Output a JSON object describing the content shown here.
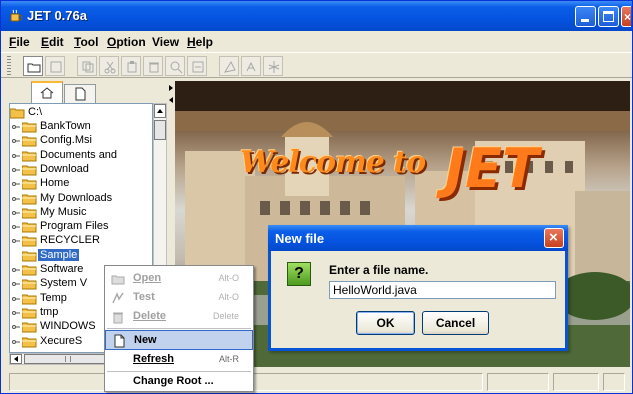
{
  "window": {
    "title": "JET 0.76a"
  },
  "menubar": {
    "items": [
      {
        "label": "File",
        "mnemonic": "F",
        "rest": "ile"
      },
      {
        "label": "Edit",
        "mnemonic": "E",
        "rest": "dit"
      },
      {
        "label": "Tool",
        "mnemonic": "T",
        "rest": "ool"
      },
      {
        "label": "Option",
        "mnemonic": "O",
        "rest": "ption"
      },
      {
        "label": "View",
        "mnemonic": "",
        "rest": "View"
      },
      {
        "label": "Help",
        "mnemonic": "H",
        "rest": "elp"
      }
    ]
  },
  "toolbar": {
    "tools": [
      "open-folder-icon",
      "save-icon",
      "copy-icon",
      "cut-icon",
      "paste-icon",
      "delete-icon",
      "find-icon",
      "replace-icon",
      "compile-icon",
      "run-icon",
      "debug-icon"
    ]
  },
  "tree": {
    "root": "C:\\",
    "items": [
      "BankTown",
      "Config.Msi",
      "Documents and",
      "Download",
      "Home",
      "My Downloads",
      "My Music",
      "Program Files",
      "RECYCLER",
      "Sample",
      "Software",
      "System V",
      "Temp",
      "tmp",
      "WINDOWS",
      "XecureS"
    ],
    "selected": "Sample"
  },
  "banner": {
    "welcome": "Welcome to",
    "brand": "JET"
  },
  "context_menu": {
    "items": [
      {
        "label": "Open",
        "accel": "Alt-O",
        "enabled": false,
        "icon": "open-icon"
      },
      {
        "label": "Test",
        "accel": "Alt-O",
        "enabled": false,
        "icon": "test-icon"
      },
      {
        "label": "Delete",
        "accel": "Delete",
        "enabled": false,
        "icon": "trash-icon"
      },
      {
        "label": "New",
        "accel": "",
        "enabled": true,
        "icon": "new-file-icon",
        "highlighted": true
      },
      {
        "label": "Refresh",
        "accel": "Alt-R",
        "enabled": true,
        "icon": ""
      },
      {
        "label": "Change Root ...",
        "accel": "",
        "enabled": true,
        "icon": ""
      }
    ]
  },
  "dialog": {
    "title": "New file",
    "prompt": "Enter a file name.",
    "value": "HelloWorld.java",
    "ok_label": "OK",
    "cancel_label": "Cancel"
  }
}
